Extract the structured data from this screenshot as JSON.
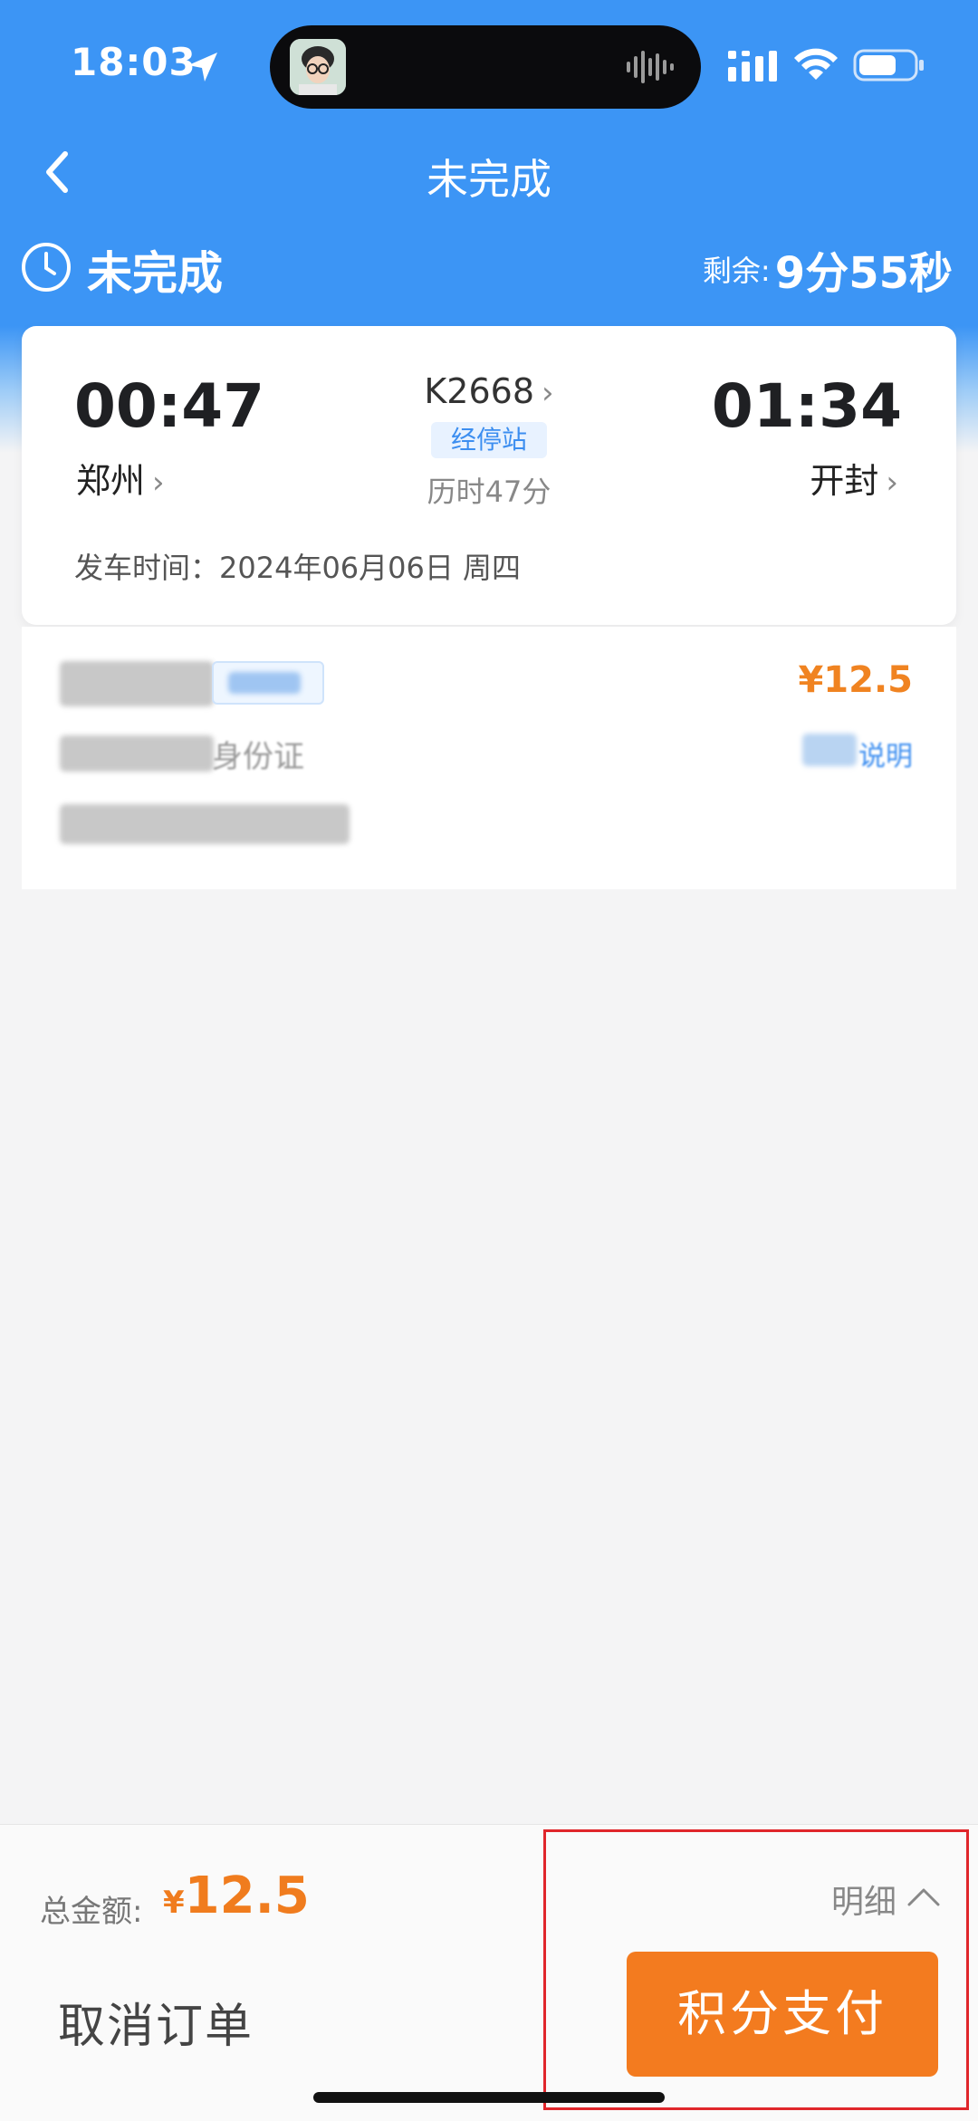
{
  "status_bar": {
    "time": "18:03"
  },
  "nav": {
    "title": "未完成"
  },
  "order_status": {
    "label": "未完成",
    "remain_label": "剩余:",
    "remain_time": "9分55秒"
  },
  "trip": {
    "departure_time": "00:47",
    "departure_station": "郑州",
    "train_number": "K2668",
    "stop_badge": "经停站",
    "duration": "历时47分",
    "arrival_time": "01:34",
    "arrival_station": "开封",
    "depart_date": "发车时间：2024年06月06日 周四"
  },
  "passenger": {
    "price": "¥12.5",
    "id_type": "身份证",
    "note": "说明"
  },
  "bottom": {
    "total_label": "总金额:",
    "total_currency": "¥",
    "total_amount": "12.5",
    "detail_label": "明细",
    "cancel_label": "取消订单",
    "pay_label": "积分支付"
  },
  "colors": {
    "brand_blue": "#3c95f5",
    "price_orange": "#f07c1e",
    "pay_button": "#f37b1f",
    "highlight": "#e0262b"
  }
}
